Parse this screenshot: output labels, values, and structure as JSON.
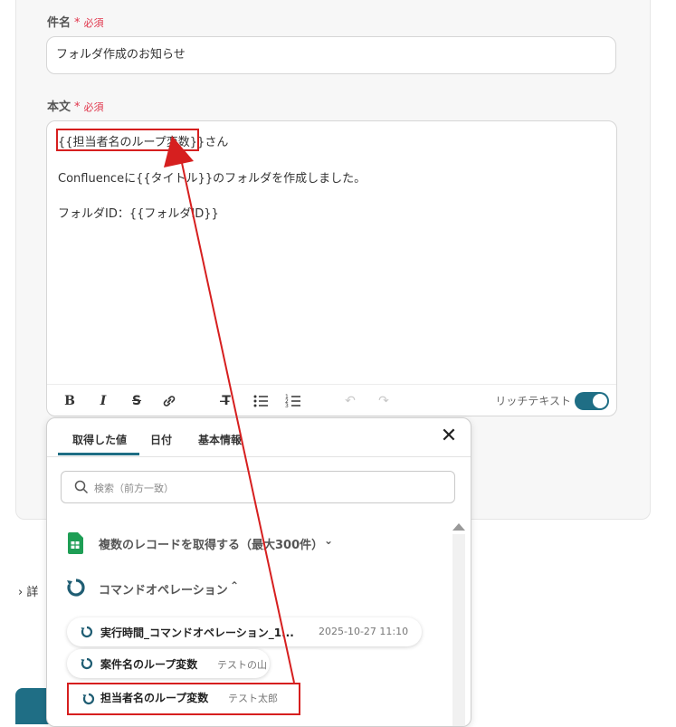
{
  "form": {
    "subject": {
      "label": "件名",
      "required_mark": "*",
      "required_text": "必須",
      "value": "フォルダ作成のお知らせ"
    },
    "body": {
      "label": "本文",
      "required_mark": "*",
      "required_text": "必須",
      "lines": {
        "line1_var": "{{担当者名のループ変数}}",
        "line1_suffix": "さん",
        "line2": "Confluenceに{{タイトル}}のフォルダを作成しました。",
        "line3": "フォルダID：{{フォルダID}}"
      }
    },
    "toolbar": {
      "rich_text_label": "リッチテキスト",
      "rich_text_enabled": true
    }
  },
  "side_link": {
    "text": "詳"
  },
  "popup": {
    "tabs": [
      "取得した値",
      "日付",
      "基本情報"
    ],
    "active_tab": "取得した値",
    "search_placeholder": "検索（前方一致）",
    "groups": [
      {
        "label": "複数のレコードを取得する（最大300件）",
        "expanded": false,
        "icon": "google-sheets-icon"
      },
      {
        "label": "コマンドオペレーション",
        "expanded": true,
        "icon": "loop-icon"
      }
    ],
    "items": [
      {
        "name": "実行時間_コマンドオペレーション_1...",
        "value": "2025-10-27 11:10"
      },
      {
        "name": "案件名のループ変数",
        "value": "テストの山"
      },
      {
        "name": "担当者名のループ変数",
        "value": "テスト太郎"
      }
    ]
  },
  "colors": {
    "accent": "#1f6e85",
    "required": "#e0344a",
    "annotation": "#d61f1f"
  }
}
